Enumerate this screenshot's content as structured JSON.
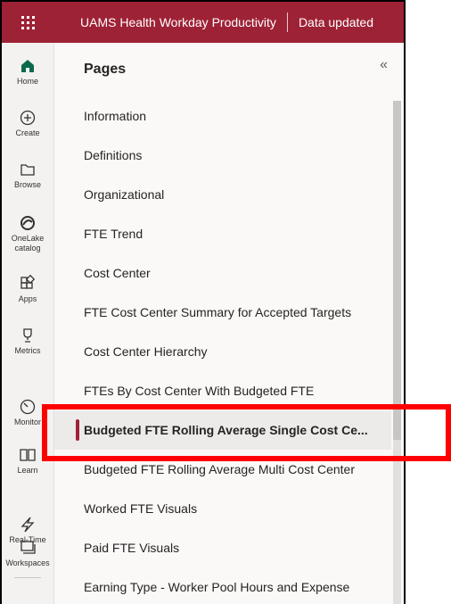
{
  "topbar": {
    "app_title": "UAMS Health Workday Productivity",
    "data_updated": "Data updated"
  },
  "rail": [
    {
      "label": "Home",
      "icon": "home-icon"
    },
    {
      "label": "Create",
      "icon": "create-icon"
    },
    {
      "label": "Browse",
      "icon": "browse-icon"
    },
    {
      "label": "OneLake catalog",
      "icon": "onelake-icon"
    },
    {
      "label": "Apps",
      "icon": "apps-icon"
    },
    {
      "label": "Metrics",
      "icon": "metrics-icon"
    },
    {
      "label": "Monitor",
      "icon": "monitor-icon"
    },
    {
      "label": "Learn",
      "icon": "learn-icon"
    },
    {
      "label": "Real-Time",
      "icon": "real-time-icon"
    },
    {
      "label": "Workspaces",
      "icon": "workspaces-icon"
    }
  ],
  "pages_panel": {
    "title": "Pages",
    "collapse_glyph": "«",
    "items": [
      {
        "label": "Information"
      },
      {
        "label": "Definitions"
      },
      {
        "label": "Organizational"
      },
      {
        "label": "FTE Trend"
      },
      {
        "label": "Cost Center"
      },
      {
        "label": "FTE Cost Center Summary for Accepted Targets"
      },
      {
        "label": "Cost Center Hierarchy"
      },
      {
        "label": "FTEs By Cost Center With Budgeted FTE"
      },
      {
        "label": "Budgeted FTE Rolling Average Single Cost Ce..."
      },
      {
        "label": "Budgeted FTE Rolling Average Multi Cost Center"
      },
      {
        "label": "Worked FTE Visuals"
      },
      {
        "label": "Paid FTE Visuals"
      },
      {
        "label": "Earning Type - Worker Pool Hours and Expense"
      }
    ],
    "active_index": 8
  },
  "colors": {
    "brand": "#9e2236",
    "highlight": "#ff0000"
  }
}
